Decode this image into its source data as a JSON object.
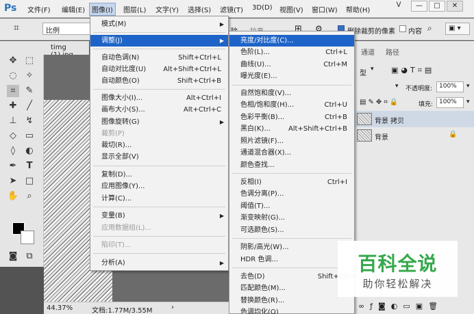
{
  "app": {
    "logo": "Ps"
  },
  "menubar": {
    "items": [
      "文件(F)",
      "编辑(E)",
      "图像(I)",
      "图层(L)",
      "文字(Y)",
      "选择(S)",
      "滤镜(T)",
      "3D(D)",
      "视图(V)",
      "窗口(W)",
      "帮助(H)"
    ],
    "window_controls": [
      "ᐯ",
      "—",
      "□",
      "✕"
    ]
  },
  "options_bar": {
    "ratio": "比例",
    "partial_a": "除",
    "partial_b": "拉直",
    "delete_cropped": "删除裁剪的像素",
    "content_aware": "内容"
  },
  "document": {
    "tab": "timg (1).jpg",
    "zoom": "44.37%",
    "doc_size": "文档:1.77M/3.55M"
  },
  "image_menu": {
    "items": [
      {
        "label": "模式(M)",
        "shortcut": "",
        "submenu": true,
        "disabled": false
      },
      {
        "label": "调整(J)",
        "shortcut": "",
        "submenu": true,
        "disabled": false,
        "highlighted": true
      },
      {
        "label": "自动色调(N)",
        "shortcut": "Shift+Ctrl+L"
      },
      {
        "label": "自动对比度(U)",
        "shortcut": "Alt+Shift+Ctrl+L"
      },
      {
        "label": "自动颜色(O)",
        "shortcut": "Shift+Ctrl+B"
      },
      {
        "label": "图像大小(I)...",
        "shortcut": "Alt+Ctrl+I"
      },
      {
        "label": "画布大小(S)...",
        "shortcut": "Alt+Ctrl+C"
      },
      {
        "label": "图像旋转(G)",
        "shortcut": "",
        "submenu": true
      },
      {
        "label": "裁剪(P)",
        "shortcut": "",
        "disabled": true
      },
      {
        "label": "裁切(R)...",
        "shortcut": ""
      },
      {
        "label": "显示全部(V)",
        "shortcut": ""
      },
      {
        "label": "复制(D)...",
        "shortcut": ""
      },
      {
        "label": "应用图像(Y)...",
        "shortcut": ""
      },
      {
        "label": "计算(C)...",
        "shortcut": ""
      },
      {
        "label": "变量(B)",
        "shortcut": "",
        "submenu": true
      },
      {
        "label": "应用数据组(L)...",
        "shortcut": "",
        "disabled": true
      },
      {
        "label": "陷印(T)...",
        "shortcut": "",
        "disabled": true
      },
      {
        "label": "分析(A)",
        "shortcut": "",
        "submenu": true
      }
    ]
  },
  "adjust_menu": {
    "items": [
      {
        "label": "亮度/对比度(C)...",
        "shortcut": "",
        "highlighted": true
      },
      {
        "label": "色阶(L)...",
        "shortcut": "Ctrl+L"
      },
      {
        "label": "曲线(U)...",
        "shortcut": "Ctrl+M"
      },
      {
        "label": "曝光度(E)...",
        "shortcut": ""
      },
      {
        "label": "自然饱和度(V)...",
        "shortcut": ""
      },
      {
        "label": "色相/饱和度(H)...",
        "shortcut": "Ctrl+U"
      },
      {
        "label": "色彩平衡(B)...",
        "shortcut": "Ctrl+B"
      },
      {
        "label": "黑白(K)...",
        "shortcut": "Alt+Shift+Ctrl+B"
      },
      {
        "label": "照片滤镜(F)...",
        "shortcut": ""
      },
      {
        "label": "通道混合器(X)...",
        "shortcut": ""
      },
      {
        "label": "颜色查找...",
        "shortcut": ""
      },
      {
        "label": "反相(I)",
        "shortcut": "Ctrl+I"
      },
      {
        "label": "色调分离(P)...",
        "shortcut": ""
      },
      {
        "label": "阈值(T)...",
        "shortcut": ""
      },
      {
        "label": "渐变映射(G)...",
        "shortcut": ""
      },
      {
        "label": "可选颜色(S)...",
        "shortcut": ""
      },
      {
        "label": "阴影/高光(W)...",
        "shortcut": ""
      },
      {
        "label": "HDR 色调...",
        "shortcut": ""
      },
      {
        "label": "去色(D)",
        "shortcut": "Shift+Ctrl+"
      },
      {
        "label": "匹配颜色(M)...",
        "shortcut": ""
      },
      {
        "label": "替换颜色(R)...",
        "shortcut": ""
      },
      {
        "label": "色调均化(Q)",
        "shortcut": ""
      }
    ]
  },
  "panels": {
    "tabs": [
      "通道",
      "路径"
    ],
    "kind_prefix": "型",
    "opacity_label": "不透明度:",
    "opacity": "100%",
    "fill_label": "填充:",
    "fill": "100%",
    "layers": [
      {
        "name": "背景 拷贝",
        "selected": true
      },
      {
        "name": "背景",
        "selected": false
      }
    ]
  },
  "watermark": {
    "title": "百科全说",
    "subtitle": "助你轻松解决"
  }
}
